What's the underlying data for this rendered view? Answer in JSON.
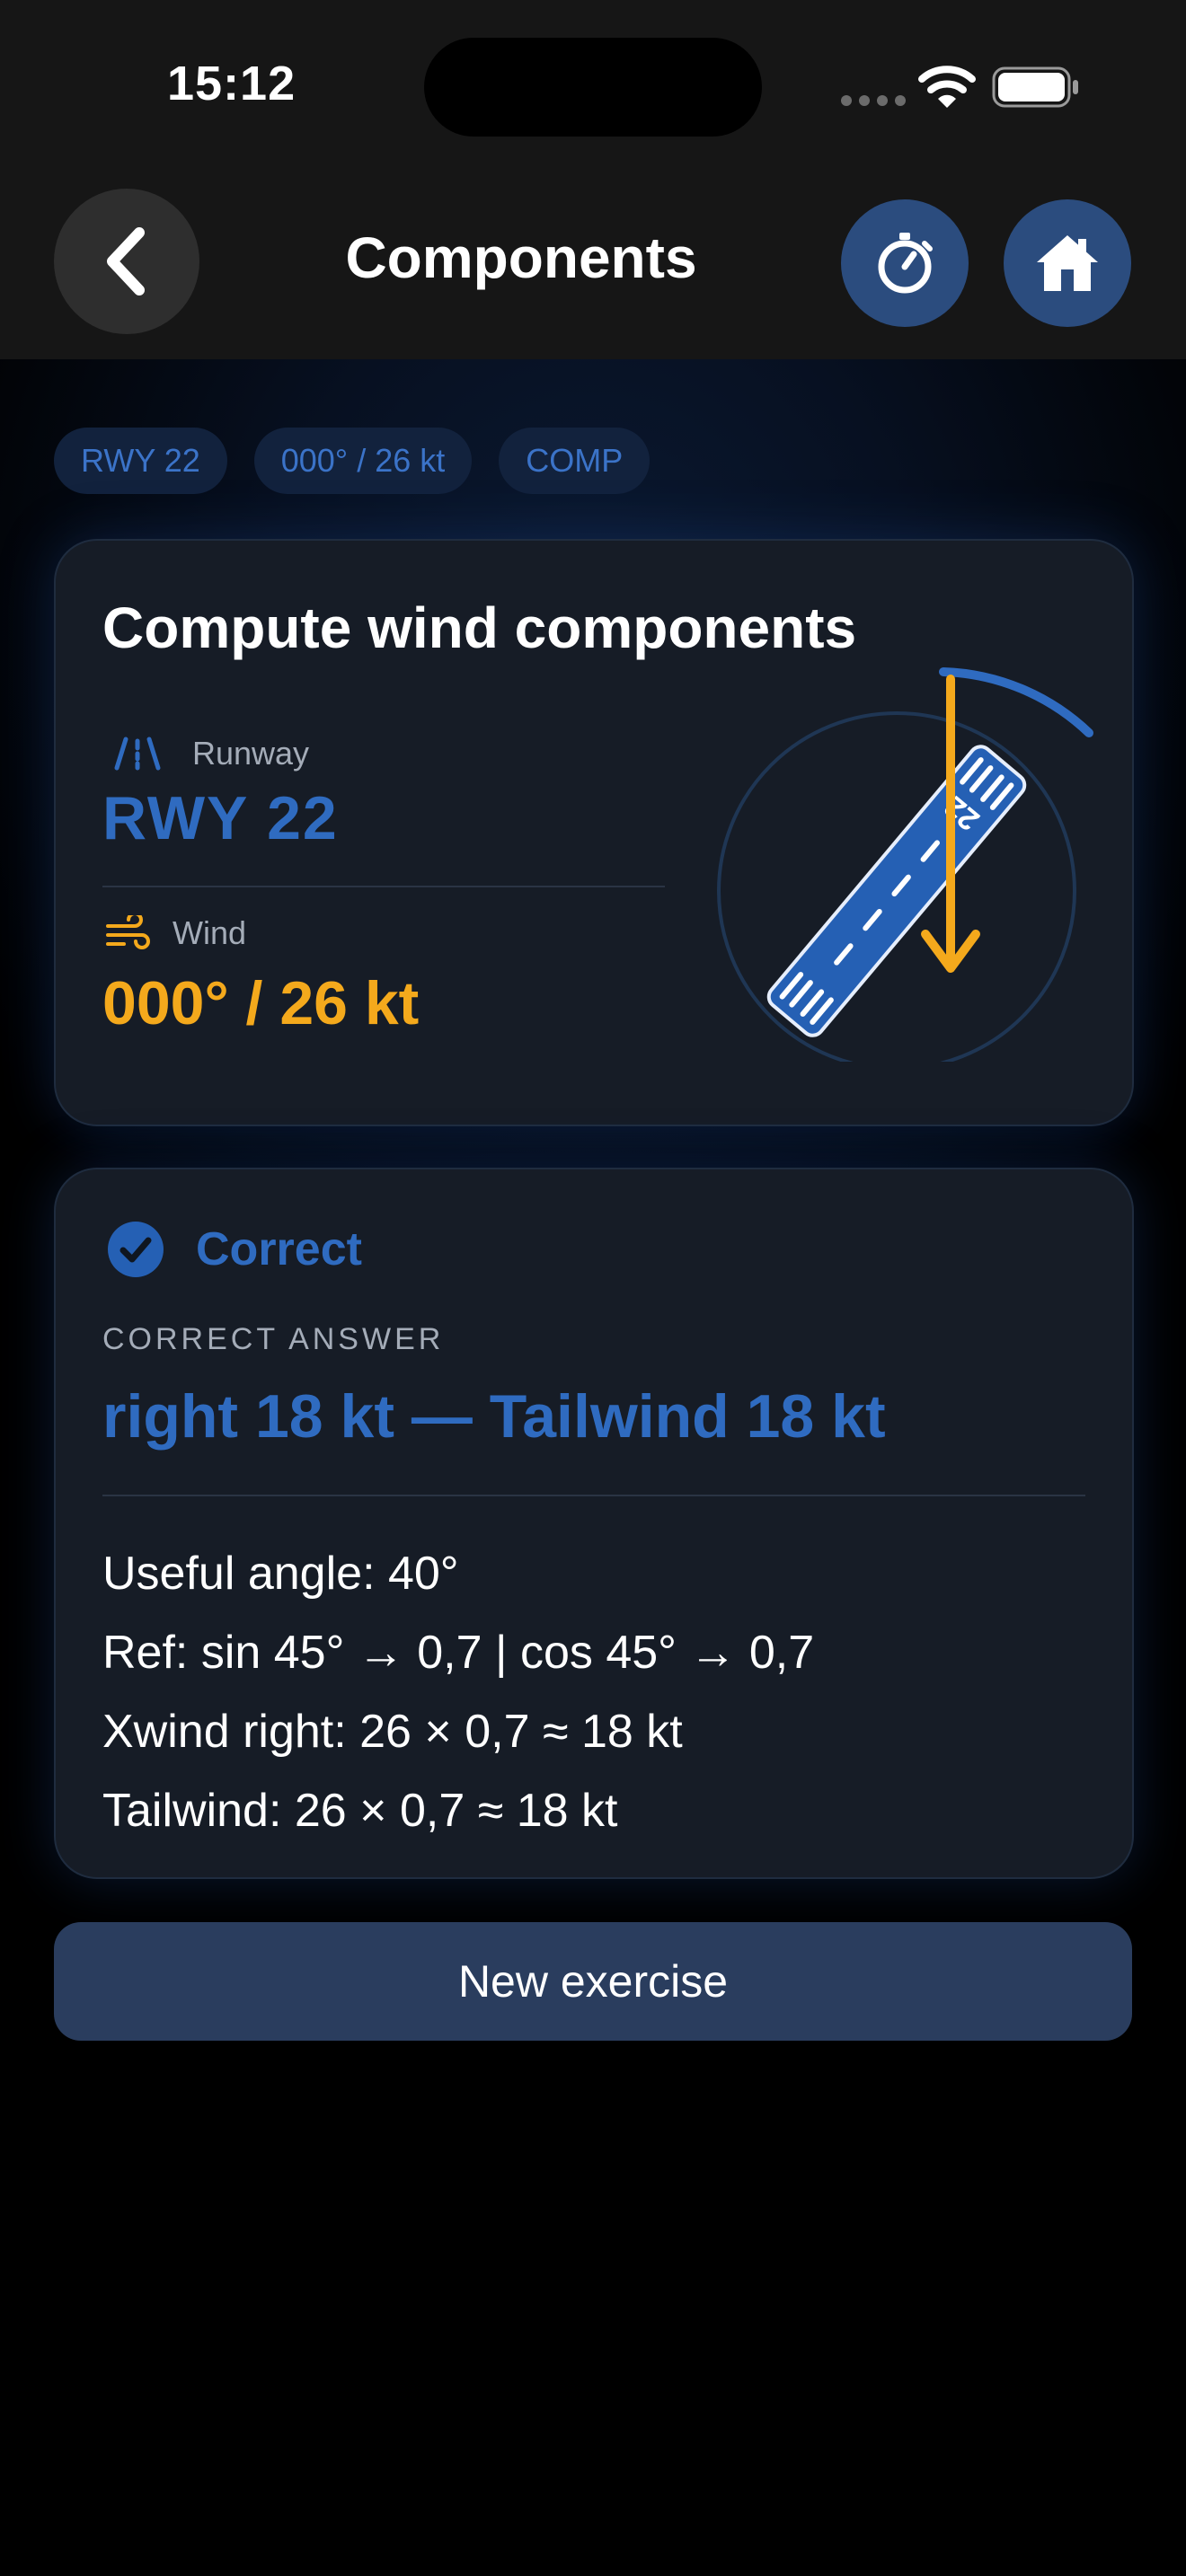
{
  "status_bar": {
    "time": "15:12"
  },
  "nav": {
    "title": "Components",
    "back_icon": "chevron-left-icon",
    "timer_icon": "stopwatch-icon",
    "home_icon": "home-icon"
  },
  "chips": [
    "RWY 22",
    "000° / 26 kt",
    "COMP"
  ],
  "question": {
    "title": "Compute wind components",
    "runway_label": "Runway",
    "runway_value": "RWY 22",
    "wind_label": "Wind",
    "wind_value": "000° / 26 kt",
    "diagram": {
      "runway_number": "22",
      "runway_heading_deg": 220,
      "wind_from_deg": 0
    }
  },
  "result": {
    "status": "Correct",
    "answer_caption": "CORRECT ANSWER",
    "answer_value": "right 18 kt — Tailwind 18 kt",
    "explanation": [
      "Useful angle: 40°",
      "Ref: sin 45° → 0,7 | cos 45° → 0,7",
      "Xwind right: 26 × 0,7 ≈ 18 kt",
      "Tailwind: 26 × 0,7 ≈ 18 kt"
    ]
  },
  "actions": {
    "new_exercise_label": "New exercise"
  },
  "colors": {
    "accent_blue": "#2f6bc0",
    "wind_amber": "#f4a91c",
    "card_bg": "#161c26",
    "nav_round_bg": "#2b4c7e",
    "button_bg": "#2a3d5e"
  }
}
